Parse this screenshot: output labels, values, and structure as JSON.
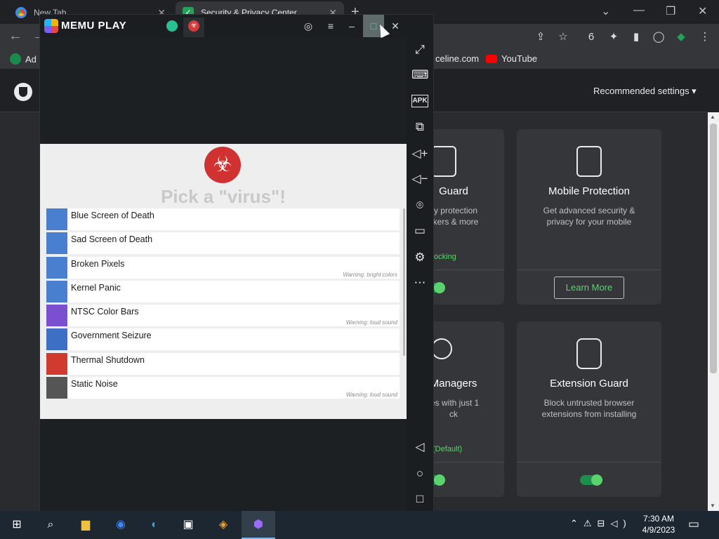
{
  "chrome": {
    "tabs": [
      {
        "label": "New Tab"
      },
      {
        "label": "Security & Privacy Center"
      }
    ],
    "new_tab_symbol": "+",
    "bookmarks": [
      {
        "label": "Ad"
      },
      {
        "label": "celine.com"
      },
      {
        "label": "YouTube"
      }
    ],
    "recommended_settings": "Recommended settings ▾",
    "cards": [
      {
        "title": "Guard",
        "desc": "cy protection\nckers & more",
        "status": "ocking",
        "control": "toggle"
      },
      {
        "title": "Mobile Protection",
        "desc": "Get advanced security & privacy for your mobile",
        "button": "Learn More"
      },
      {
        "title": "Managers",
        "desc": "tes with just 1\nck",
        "status": "(Default)",
        "control": "toggle"
      },
      {
        "title": "Extension Guard",
        "desc": "Block untrusted browser extensions from installing",
        "control": "toggle"
      }
    ]
  },
  "memu": {
    "title": "MEMU PLAY",
    "app": {
      "title": "Pick a \"virus\"!",
      "items": [
        {
          "label": "Blue Screen of Death",
          "warning": "",
          "icon_color": "#4a7fd0",
          "icon": "bsod-icon"
        },
        {
          "label": "Sad Screen of Death",
          "warning": "",
          "icon_color": "#4a7fd0",
          "icon": "sad-face-icon"
        },
        {
          "label": "Broken Pixels",
          "warning": "Warning: bright colors",
          "icon_color": "#4a7fd0",
          "icon": "broken-image-icon"
        },
        {
          "label": "Kernel Panic",
          "warning": "",
          "icon_color": "#4a7fd0",
          "icon": "power-icon"
        },
        {
          "label": "NTSC Color Bars",
          "warning": "Warning: loud sound",
          "icon_color": "#7a4fd0",
          "icon": "color-bars-icon"
        },
        {
          "label": "Government Seizure",
          "warning": "",
          "icon_color": "#3d6fc4",
          "icon": "badge-icon"
        },
        {
          "label": "Thermal Shutdown",
          "warning": "",
          "icon_color": "#d03a2f",
          "icon": "flame-icon"
        },
        {
          "label": "Static Noise",
          "warning": "Warning: loud sound",
          "icon_color": "#555555",
          "icon": "noise-icon"
        }
      ]
    },
    "sidebar_icons": [
      "fullscreen-icon",
      "keyboard-icon",
      "apk-icon",
      "multi-window-icon",
      "volume-up-icon",
      "volume-down-icon",
      "location-icon",
      "folder-icon",
      "settings-icon",
      "more-icon",
      "back-icon",
      "home-icon",
      "recents-icon"
    ],
    "apk_label": "APK"
  },
  "taskbar": {
    "time": "7:30 AM",
    "date": "4/9/2023"
  }
}
